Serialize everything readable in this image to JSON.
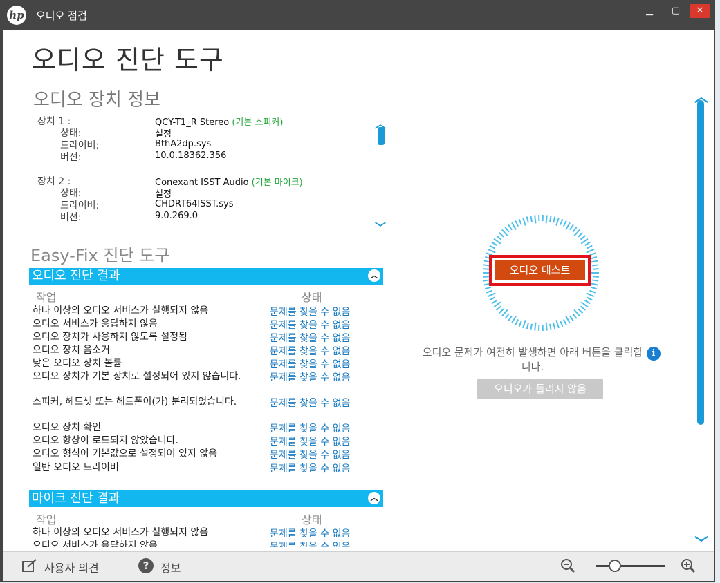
{
  "window": {
    "title": "오디오 점검",
    "logo": "hp"
  },
  "main": {
    "title": "오디오 진단 도구"
  },
  "device_info": {
    "heading": "오디오 장치 정보",
    "devices": [
      {
        "label": "장치 1 :",
        "name": "QCY-T1_R Stereo",
        "tag": "(기본 스피커)",
        "status_label": "상태:",
        "status": "설정",
        "driver_label": "드라이버:",
        "driver": "BthA2dp.sys",
        "version_label": "버전:",
        "version": "10.0.18362.356"
      },
      {
        "label": "장치 2 :",
        "name": "Conexant ISST Audio",
        "tag": "(기본 마이크)",
        "status_label": "상태:",
        "status": "설정",
        "driver_label": "드라이버:",
        "driver": "CHDRT64ISST.sys",
        "version_label": "버전:",
        "version": "9.0.269.0"
      }
    ]
  },
  "easyfix": {
    "heading": "Easy-Fix 진단 도구",
    "audio_section": {
      "title": "오디오 진단 결과",
      "col_task": "작업",
      "col_status": "상태",
      "rows": [
        {
          "task": "하나 이상의 오디오 서비스가 실행되지 않음",
          "status": "문제를 찾을 수 없음"
        },
        {
          "task": "오디오 서비스가 응답하지 않음",
          "status": "문제를 찾을 수 없음"
        },
        {
          "task": "오디오 장치가 사용하지 않도록 설정됨",
          "status": "문제를 찾을 수 없음"
        },
        {
          "task": "오디오 장치 음소거",
          "status": "문제를 찾을 수 없음"
        },
        {
          "task": "낮은 오디오 장치 볼륨",
          "status": "문제를 찾을 수 없음"
        },
        {
          "task": "오디오 장치가 기본 장치로 설정되어 있지 않습니다.",
          "status": "문제를 찾을 수 없음"
        },
        {
          "task": "스피커, 헤드셋 또는 헤드폰이(가) 분리되었습니다.",
          "status": "문제를 찾을 수 없음"
        },
        {
          "task": "오디오 장치 확인",
          "status": "문제를 찾을 수 없음"
        },
        {
          "task": "오디오 향상이 로드되지 않았습니다.",
          "status": "문제를 찾을 수 없음"
        },
        {
          "task": "오디오 형식이 기본값으로 설정되어 있지 않음",
          "status": "문제를 찾을 수 없음"
        },
        {
          "task": "일반 오디오 드라이버",
          "status": "문제를 찾을 수 없음"
        }
      ]
    },
    "mic_section": {
      "title": "마이크 진단 결과",
      "col_task": "작업",
      "col_status": "상태",
      "rows": [
        {
          "task": "하나 이상의 오디오 서비스가 실행되지 않음",
          "status": "문제를 찾을 수 없음"
        },
        {
          "task": "오디오 서비스가 응답하지 않음",
          "status": "문제를 찾을 수 없음"
        }
      ]
    }
  },
  "test_panel": {
    "test_button": "오디오 테스트",
    "help_text": "오디오 문제가 여전히 발생하면 아래 버튼을 클릭합니다.",
    "no_audio_button": "오디오가 들리지 않음"
  },
  "footer": {
    "feedback_label": "사용자 의견",
    "info_label": "정보"
  }
}
